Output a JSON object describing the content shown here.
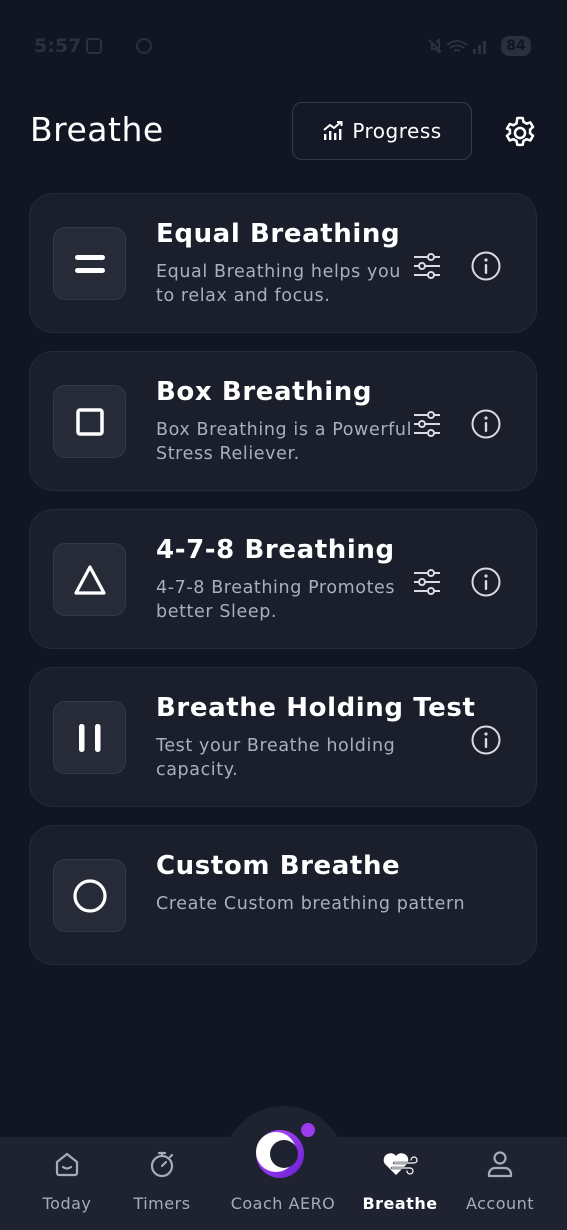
{
  "status_bar": {
    "time": "5:57",
    "battery": "84"
  },
  "header": {
    "title": "Breathe",
    "progress_label": "Progress"
  },
  "cards": [
    {
      "title": "Equal Breathing",
      "description": "Equal Breathing helps you to relax and focus.",
      "icon": "equals-icon"
    },
    {
      "title": "Box Breathing",
      "description": "Box Breathing is a Powerful Stress Reliever.",
      "icon": "square-icon"
    },
    {
      "title": "4-7-8 Breathing",
      "description": "4-7-8 Breathing Promotes better Sleep.",
      "icon": "triangle-icon"
    },
    {
      "title": "Breathe Holding Test",
      "description": "Test your Breathe holding capacity.",
      "icon": "pause-icon"
    },
    {
      "title": "Custom Breathe",
      "description": "Create Custom breathing pattern",
      "icon": "circle-icon"
    }
  ],
  "nav": {
    "items": [
      {
        "label": "Today",
        "icon": "home-icon"
      },
      {
        "label": "Timers",
        "icon": "stopwatch-icon"
      },
      {
        "label": "Coach AERO",
        "icon": "coach-logo"
      },
      {
        "label": "Breathe",
        "icon": "heart-wind-icon"
      },
      {
        "label": "Account",
        "icon": "user-icon"
      }
    ],
    "active": "Breathe"
  },
  "colors": {
    "background": "#121622",
    "card": "#1b1f2b",
    "nav": "#1f2331",
    "accent": "#8b2fe8",
    "muted_text": "#a9afbd"
  }
}
